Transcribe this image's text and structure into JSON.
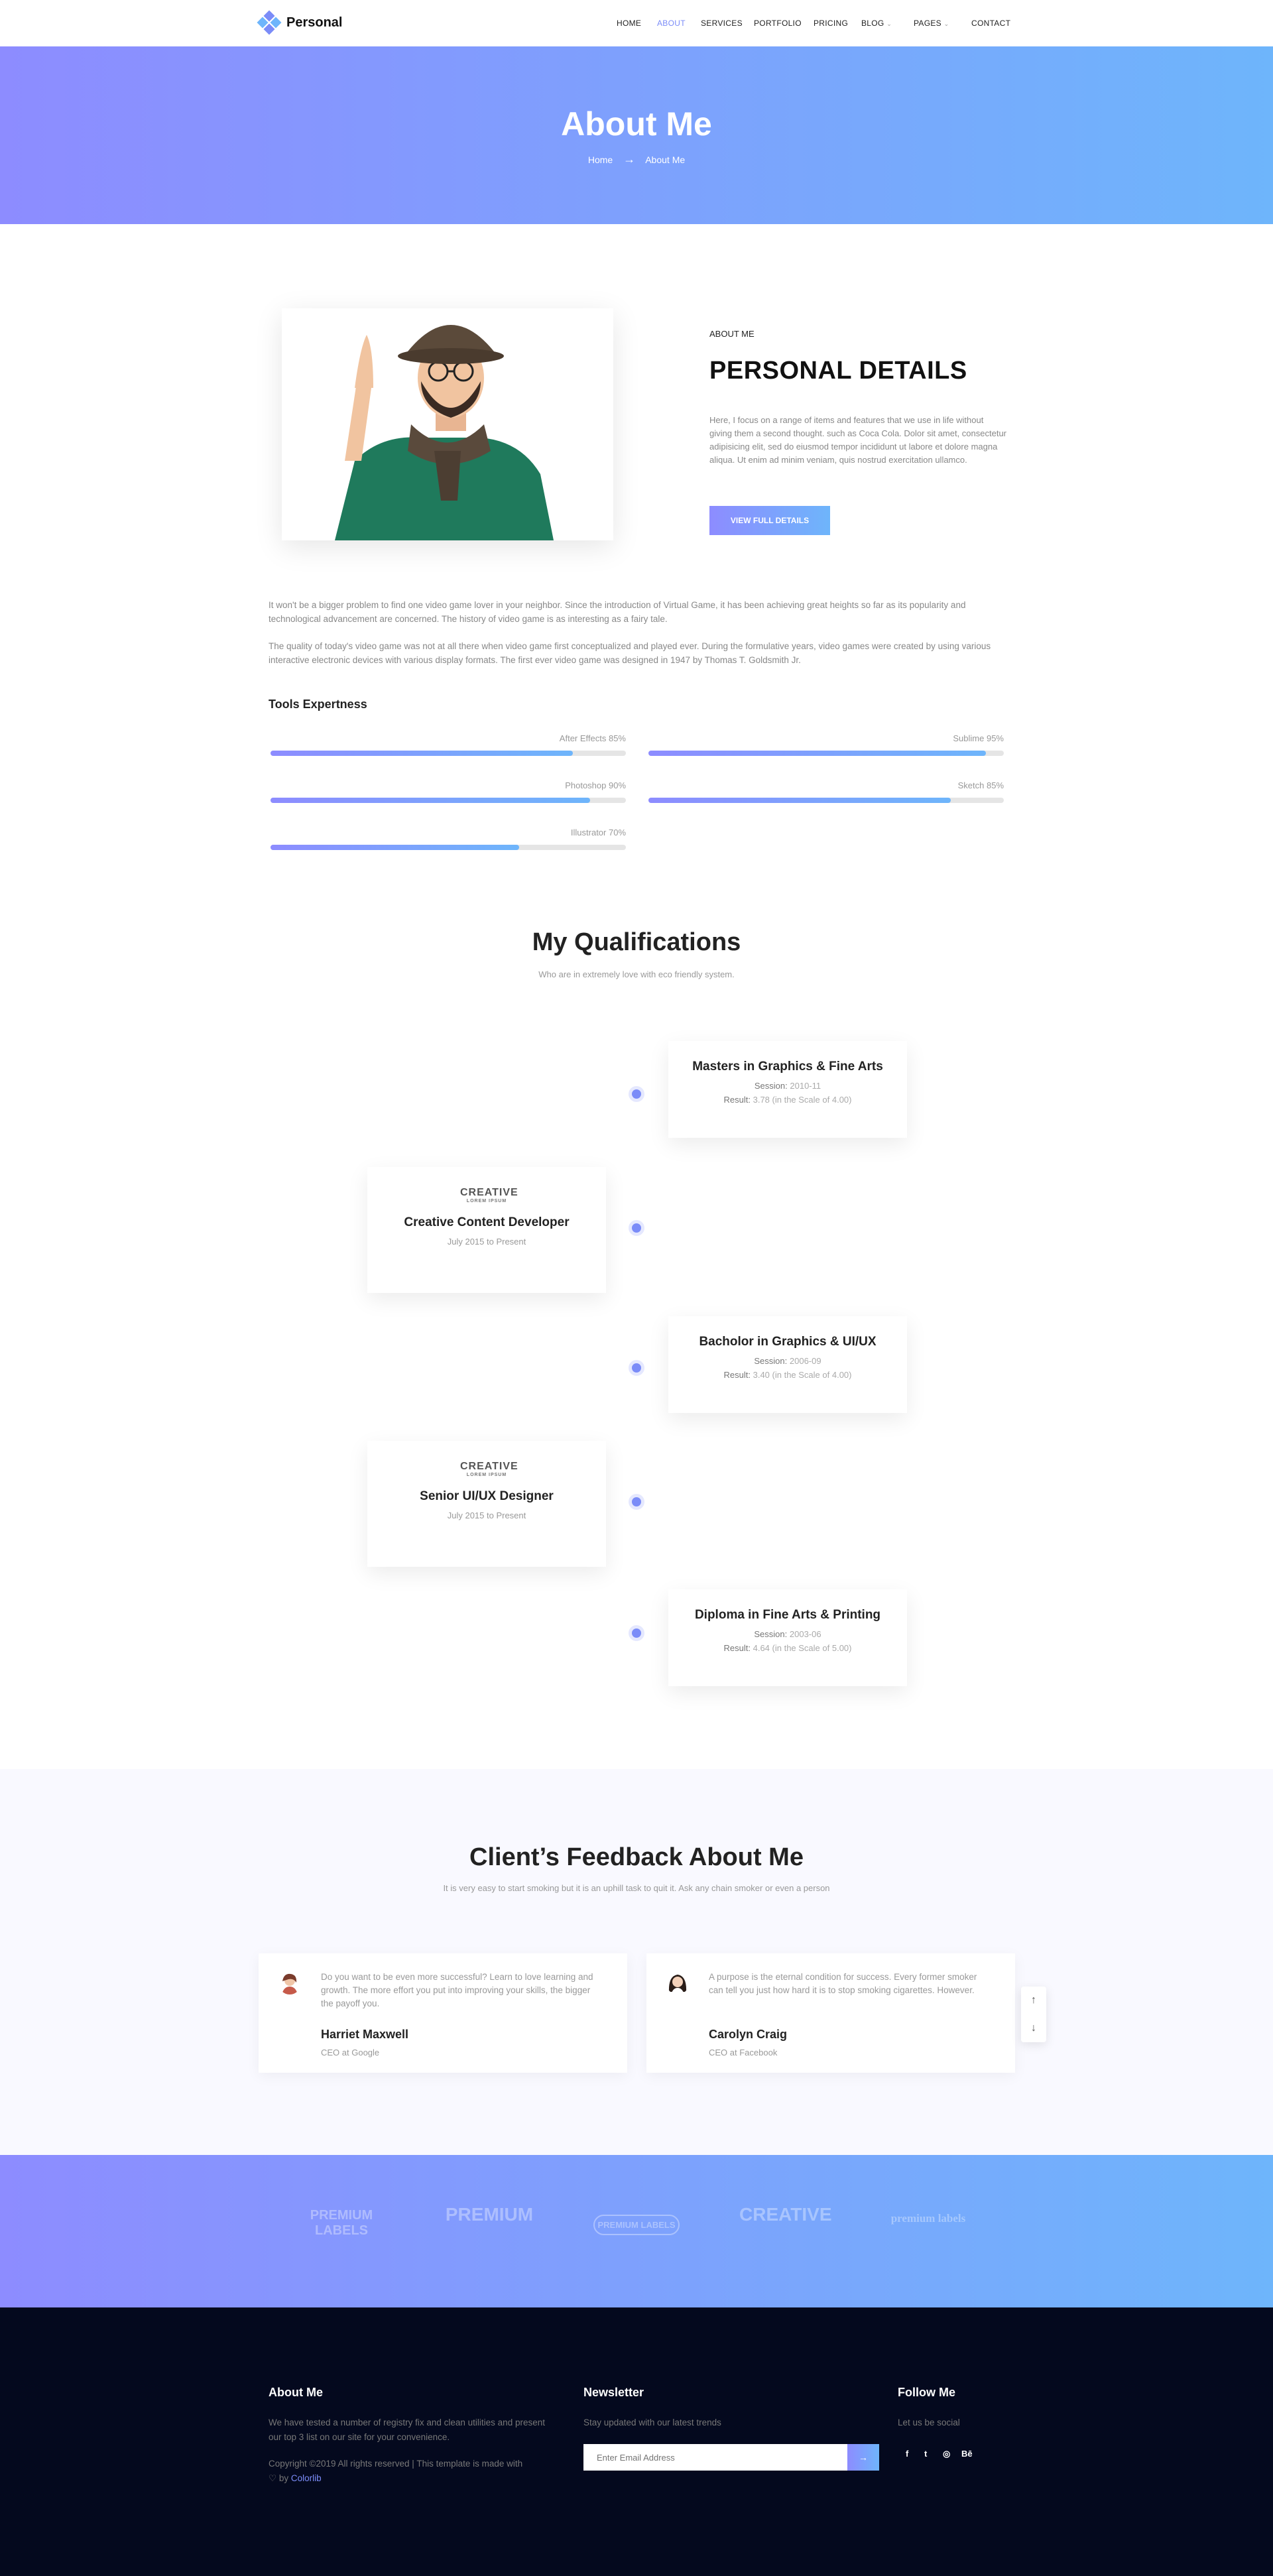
{
  "nav": {
    "brand": "Personal",
    "items": [
      {
        "label": "HOME"
      },
      {
        "label": "ABOUT"
      },
      {
        "label": "SERVICES"
      },
      {
        "label": "PORTFOLIO"
      },
      {
        "label": "PRICING"
      },
      {
        "label": "BLOG"
      },
      {
        "label": "PAGES"
      },
      {
        "label": "CONTACT"
      }
    ]
  },
  "hero": {
    "title": "About Me",
    "crumb_home": "Home",
    "crumb_arrow": "→",
    "crumb_current": "About Me"
  },
  "about": {
    "subtitle": "ABOUT ME",
    "title": "PERSONAL DETAILS",
    "text": "Here, I focus on a range of items and features that we use in life without giving them a second thought. such as Coca Cola. Dolor sit amet, consectetur adipisicing elit, sed do eiusmod tempor incididunt ut labore et dolore magna aliqua. Ut enim ad minim veniam, quis nostrud exercitation ullamco.",
    "button": "VIEW FULL DETAILS",
    "para1": "It won't be a bigger problem to find one video game lover in your neighbor. Since the introduction of Virtual Game, it has been achieving great heights so far as its popularity and technological advancement are concerned. The history of video game is as interesting as a fairy tale.",
    "para2": "The quality of today's video game was not at all there when video game first conceptualized and played ever. During the formulative years, video games were created by using various interactive electronic devices with various display formats. The first ever video game was designed in 1947 by Thomas T. Goldsmith Jr."
  },
  "tools": {
    "title": "Tools Expertness",
    "skills": [
      {
        "label": "After Effects 85%",
        "percent": 85
      },
      {
        "label": "Sublime 95%",
        "percent": 95
      },
      {
        "label": "Photoshop 90%",
        "percent": 90
      },
      {
        "label": "Sketch 85%",
        "percent": 85
      },
      {
        "label": "Illustrator 70%",
        "percent": 70
      }
    ]
  },
  "qualifications": {
    "title": "My Qualifications",
    "subtitle": "Who are in extremely love with eco friendly system.",
    "items": [
      {
        "title": "Masters in Graphics & Fine Arts",
        "session_label": "Session:",
        "session": "2010-11",
        "result_label": "Result:",
        "result": "3.78 (in the Scale of 4.00)"
      },
      {
        "logo": "CREATIVE",
        "logo_small": "LOREM IPSUM",
        "title": "Creative Content Developer",
        "period": "July 2015 to Present"
      },
      {
        "title": "Bacholor in Graphics & UI/UX",
        "session_label": "Session:",
        "session": "2006-09",
        "result_label": "Result:",
        "result": "3.40 (in the Scale of 4.00)"
      },
      {
        "logo": "CREATIVE",
        "logo_small": "LOREM IPSUM",
        "title": "Senior UI/UX Designer",
        "period": "July 2015 to Present"
      },
      {
        "title": "Diploma in Fine Arts & Printing",
        "session_label": "Session:",
        "session": "2003-06",
        "result_label": "Result:",
        "result": "4.64 (in the Scale of 5.00)"
      }
    ]
  },
  "feedback": {
    "title": "Client’s Feedback About Me",
    "subtitle": "It is very easy to start smoking but it is an uphill task to quit it. Ask any chain smoker or even a person",
    "items": [
      {
        "text": "Do you want to be even more successful? Learn to love learning and growth. The more effort you put into improving your skills, the bigger the payoff you.",
        "name": "Harriet Maxwell",
        "role": "CEO at Google"
      },
      {
        "text": "A purpose is the eternal condition for success. Every former smoker can tell you just how hard it is to stop smoking cigarettes. However.",
        "name": "Carolyn Craig",
        "role": "CEO at Facebook"
      }
    ],
    "scroll_up": "↑",
    "scroll_down": "↓"
  },
  "brands": [
    {
      "name": "PREMIUM LABELS"
    },
    {
      "name": "PREMIUM"
    },
    {
      "name": "PREMIUM LABELS"
    },
    {
      "name": "CREATIVE"
    },
    {
      "name": "premium labels"
    }
  ],
  "footer": {
    "about_title": "About Me",
    "about_text": "We have tested a number of registry fix and clean utilities and present our top 3 list on our site for your convenience.",
    "copyright": "Copyright ©2019 All rights reserved | This template is made with",
    "heart": "♡ by",
    "colorlib": "Colorlib",
    "newsletter_title": "Newsletter",
    "newsletter_text": "Stay updated with our latest trends",
    "email_placeholder": "Enter Email Address",
    "submit_arrow": "→",
    "follow_title": "Follow Me",
    "follow_text": "Let us be social",
    "socials": [
      {
        "icon": "f"
      },
      {
        "icon": "t"
      },
      {
        "icon": "◎"
      },
      {
        "icon": "Bē"
      }
    ]
  },
  "colors": {
    "accent": "#7b8cf8",
    "gradient_start": "#8d8cff",
    "gradient_end": "#6eb5fb",
    "footer_bg": "#04091e"
  }
}
